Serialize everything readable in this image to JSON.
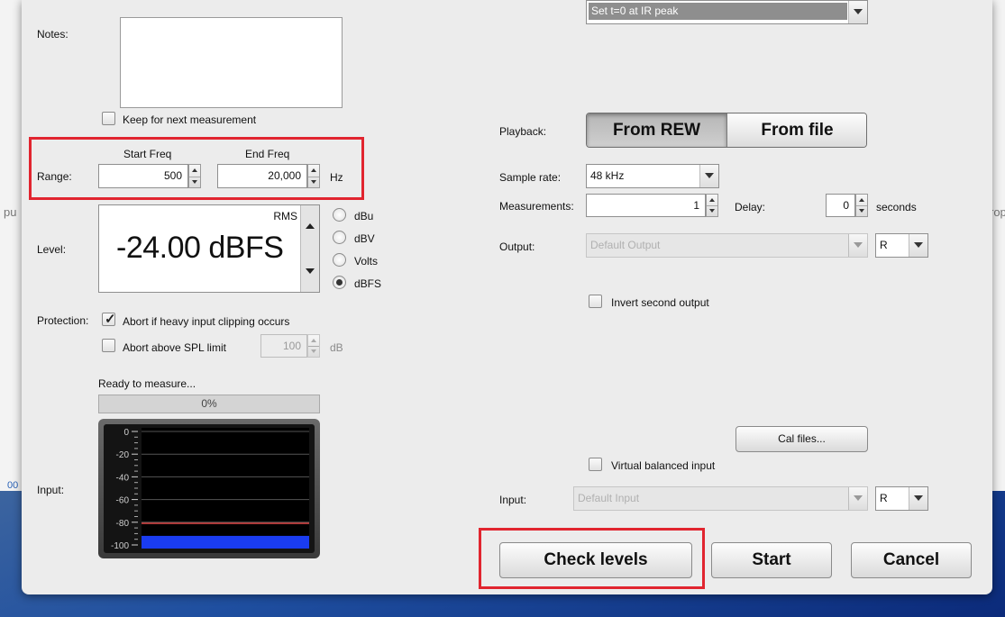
{
  "background": {
    "left_edge_text": "pu",
    "right_edge_text": "rop",
    "bottom_left_text": "00"
  },
  "left": {
    "notes_label": "Notes:",
    "keep_label": "Keep for next measurement",
    "start_freq_label": "Start Freq",
    "end_freq_label": "End Freq",
    "range_label": "Range:",
    "start_freq_value": "500",
    "end_freq_value": "20,000",
    "hz_unit": "Hz",
    "level_label": "Level:",
    "level_mode": "RMS",
    "level_value": "-24.00 dBFS",
    "units": [
      {
        "label": "dBu",
        "selected": false
      },
      {
        "label": "dBV",
        "selected": false
      },
      {
        "label": "Volts",
        "selected": false
      },
      {
        "label": "dBFS",
        "selected": true
      }
    ],
    "protection_label": "Protection:",
    "abort_clipping_label": "Abort if heavy input clipping occurs",
    "abort_clipping_checked": true,
    "abort_spl_label": "Abort above SPL limit",
    "abort_spl_checked": false,
    "spl_value": "100",
    "spl_unit": "dB",
    "status_text": "Ready to measure...",
    "progress_text": "0%",
    "progress_fraction": 0,
    "input_label": "Input:",
    "meter_scale": [
      "0",
      "-20",
      "-40",
      "-60",
      "-80",
      "-100"
    ],
    "meter_level_db": -92,
    "meter_peak_db": -81
  },
  "right": {
    "ir_option": "Set t=0 at IR peak",
    "playback_label": "Playback:",
    "playback_options": [
      "From REW",
      "From file"
    ],
    "playback_selected": "From REW",
    "sample_rate_label": "Sample rate:",
    "sample_rate_value": "48 kHz",
    "measurements_label": "Measurements:",
    "measurements_value": "1",
    "delay_label": "Delay:",
    "delay_value": "0",
    "seconds_label": "seconds",
    "output_label": "Output:",
    "output_device": "Default Output",
    "output_channel": "R",
    "invert_label": "Invert second output",
    "cal_files_label": "Cal files...",
    "virtual_balanced_label": "Virtual balanced input",
    "input_label": "Input:",
    "input_device": "Default Input",
    "input_channel": "R"
  },
  "buttons": {
    "check_levels": "Check levels",
    "start": "Start",
    "cancel": "Cancel"
  },
  "colors": {
    "highlight_red": "#e1252f",
    "meter_blue": "#1a3cf0",
    "meter_peak_red": "#e04848"
  }
}
